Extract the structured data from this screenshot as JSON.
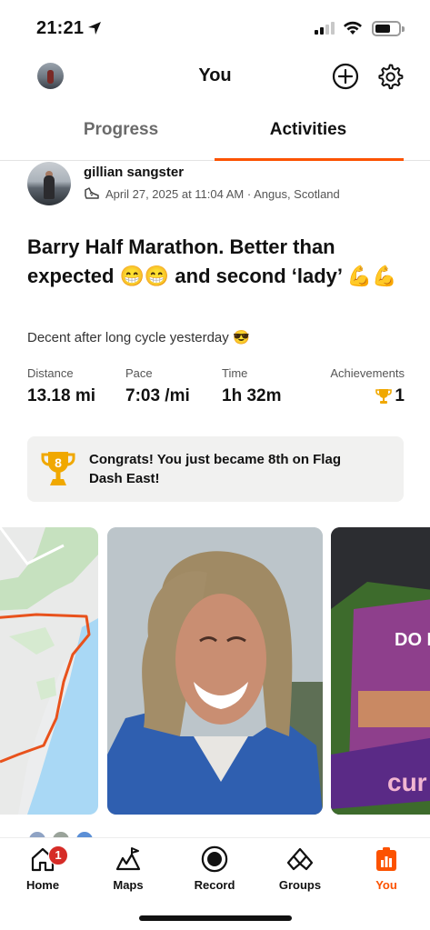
{
  "status_bar": {
    "time": "21:21"
  },
  "header": {
    "title": "You"
  },
  "tabs": [
    {
      "label": "Progress",
      "active": false
    },
    {
      "label": "Activities",
      "active": true
    }
  ],
  "activity": {
    "athlete_name": "gillian sangster",
    "meta": "April 27, 2025 at 11:04 AM · Angus, Scotland",
    "title": "Barry Half Marathon. Better than expected 😁😁 and second ‘lady’ 💪💪",
    "description": "Decent after long cycle yesterday 😎",
    "stats": {
      "distance_label": "Distance",
      "distance_value": "13.18 mi",
      "pace_label": "Pace",
      "pace_value": "7:03 /mi",
      "time_label": "Time",
      "time_value": "1h 32m",
      "achievements_label": "Achievements",
      "achievements_value": "1"
    },
    "achievement_banner": {
      "trophy_number": "8",
      "text": "Congrats! You just became 8th on Flag Dash East!"
    }
  },
  "snack_bag": {
    "brand": "DO MIX",
    "bar_text": "cur"
  },
  "tab_bar": {
    "items": [
      {
        "label": "Home",
        "icon": "home-icon",
        "badge": "1"
      },
      {
        "label": "Maps",
        "icon": "maps-icon"
      },
      {
        "label": "Record",
        "icon": "record-icon"
      },
      {
        "label": "Groups",
        "icon": "groups-icon"
      },
      {
        "label": "You",
        "icon": "you-icon",
        "active": true
      }
    ]
  },
  "colors": {
    "accent": "#fc5200",
    "badge": "#d62c27",
    "trophy": "#f0a800",
    "route": "#e8521c"
  }
}
